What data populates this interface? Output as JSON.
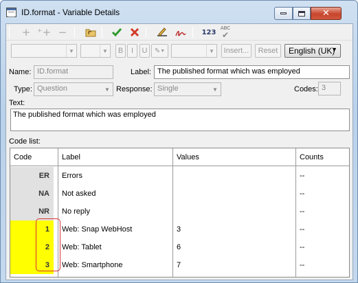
{
  "window": {
    "title": "ID.format - Variable Details",
    "buttons": {
      "minimize": "minimize",
      "maximize": "maximize",
      "close": "close"
    }
  },
  "toolbar": {
    "icons": [
      "add-icon",
      "add-multiple-icon",
      "remove-icon",
      "folder-up-icon",
      "ok-check-icon",
      "cancel-x-icon",
      "edit-label-icon",
      "signature-icon",
      "numbering-icon",
      "spellcheck-icon"
    ],
    "numbering_text": "123",
    "spell_text": "ABC"
  },
  "format_bar": {
    "bold": "B",
    "italic": "I",
    "underline": "U",
    "insert_label": "Insert...",
    "reset_label": "Reset",
    "language": "English (UK)"
  },
  "form": {
    "name_label": "Name:",
    "name_value": "ID.format",
    "label_label": "Label:",
    "label_value": "The published format which was employed",
    "type_label": "Type:",
    "type_value": "Question",
    "response_label": "Response:",
    "response_value": "Single",
    "codes_label": "Codes:",
    "codes_value": "3",
    "text_label": "Text:",
    "text_value": "The published format which was employed",
    "codelist_label": "Code list:"
  },
  "grid": {
    "headers": [
      "Code",
      "Label",
      "Values",
      "Counts"
    ],
    "rows": [
      {
        "code": "ER",
        "label": "Errors",
        "value": "",
        "counts": "--",
        "highlight": false
      },
      {
        "code": "NA",
        "label": "Not asked",
        "value": "",
        "counts": "--",
        "highlight": false
      },
      {
        "code": "NR",
        "label": "No reply",
        "value": "",
        "counts": "--",
        "highlight": false
      },
      {
        "code": "1",
        "label": "Web: Snap WebHost",
        "value": "3",
        "counts": "--",
        "highlight": true
      },
      {
        "code": "2",
        "label": "Web: Tablet",
        "value": "6",
        "counts": "--",
        "highlight": true
      },
      {
        "code": "3",
        "label": "Web: Smartphone",
        "value": "7",
        "counts": "--",
        "highlight": true
      }
    ]
  },
  "colors": {
    "highlight_fill": "#ffff00",
    "highlight_border": "#d9332f",
    "ok_green": "#2e9a2e",
    "cancel_red": "#d23a2a"
  }
}
